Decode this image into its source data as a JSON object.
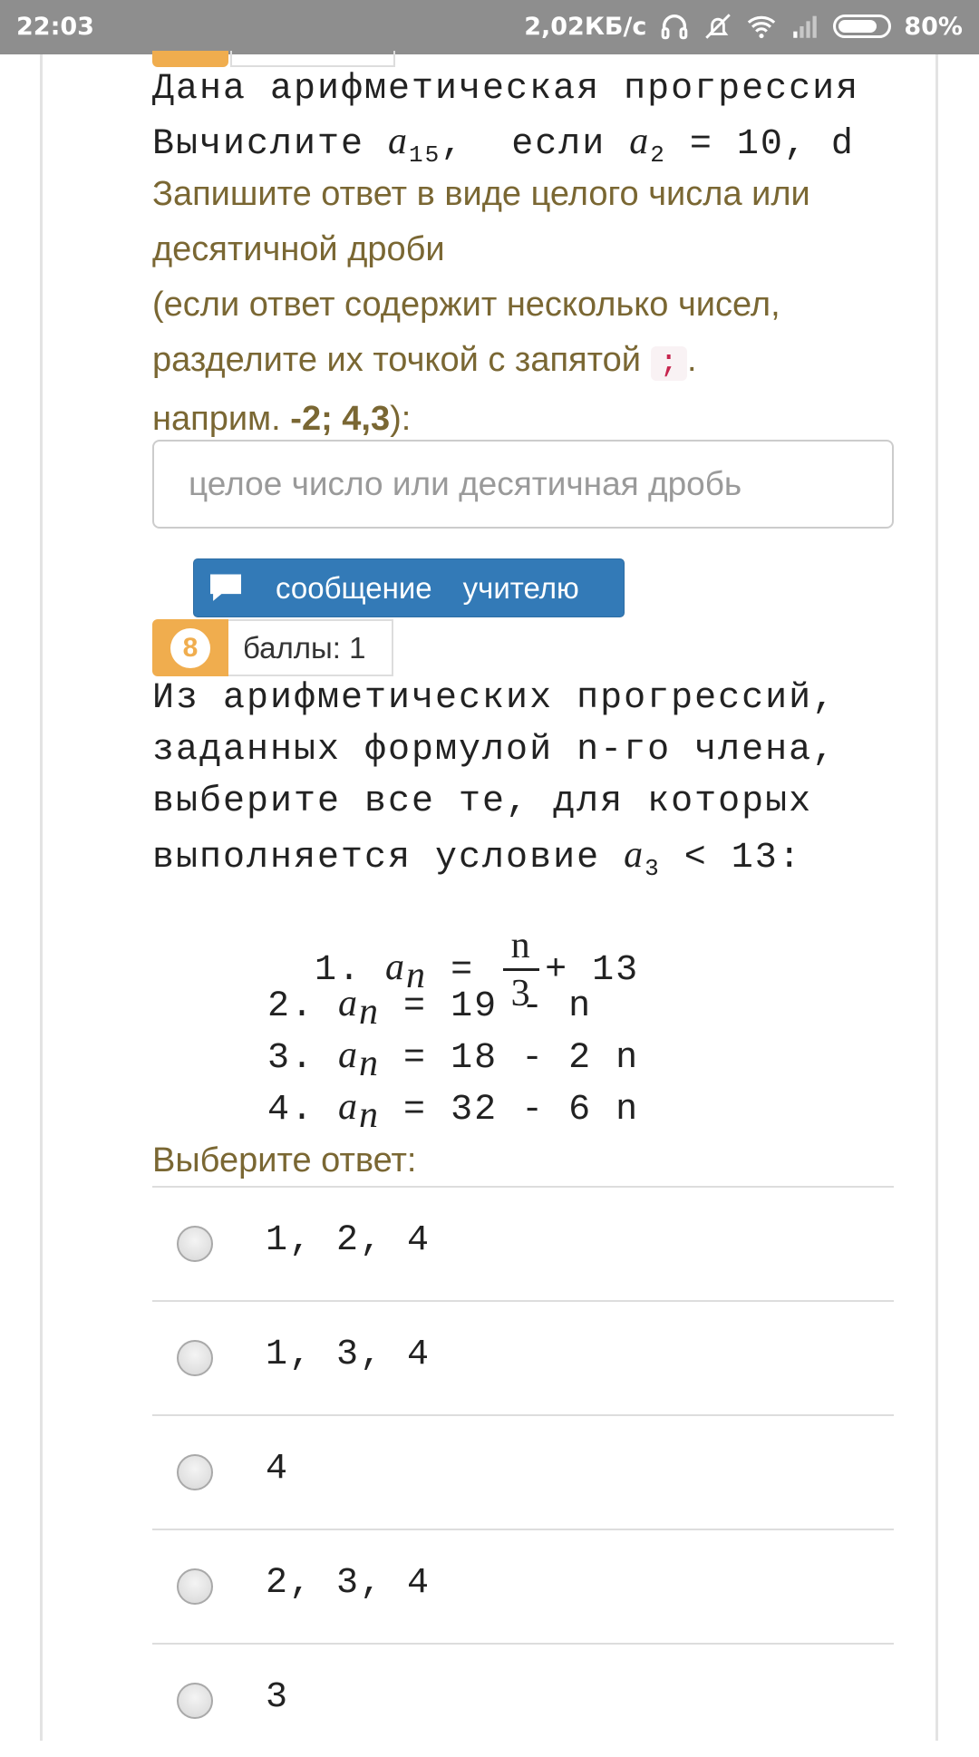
{
  "status_bar": {
    "time": "22:03",
    "net_speed": "2,02КБ/с",
    "battery": "80%",
    "battery_level": 0.8,
    "icons": [
      "headphones-icon",
      "vibrate-off-icon",
      "wifi-icon",
      "signal-icon",
      "battery-icon"
    ]
  },
  "q7": {
    "line1": "Дана арифметическая прогрессия",
    "line2_prefix": "Вычислите ",
    "line2_var1": "a",
    "line2_sub1": "15",
    "line2_mid": ",  если ",
    "line2_var2": "a",
    "line2_sub2": "2",
    "line2_suffix": " = 10, d",
    "instr1": "Запишите ответ в виде целого числа или",
    "instr2": "десятичной дроби",
    "instr3": "(если ответ содержит несколько чисел,",
    "instr4_text": "разделите их точкой с запятой ",
    "instr4_code": ";",
    "instr4_end": ".",
    "instr5_prefix": "наприм. ",
    "instr5_example": "-2; 4,3",
    "instr5_suffix": "):",
    "answer_placeholder": "целое число или десятичная дробь"
  },
  "message_button": {
    "word1": "сообщение",
    "word2": "учителю"
  },
  "q8": {
    "number": "8",
    "score": "баллы: 1",
    "text1": "Из арифметических прогрессий,",
    "text2": "заданных формулой n-го члена,",
    "text3": "выберите все те, для которых",
    "text4_prefix": "выполняется условие ",
    "text4_var": "a",
    "text4_sub": "3",
    "text4_suffix": " < 13:",
    "formulas": [
      {
        "num": "1.",
        "var": "a",
        "sub": "n",
        "eq": "=",
        "frac_num": "n",
        "frac_den": "3",
        "rest": "+ 13"
      },
      {
        "num": "2.",
        "var": "a",
        "sub": "n",
        "eq": "=",
        "rest": "19 - n"
      },
      {
        "num": "3.",
        "var": "a",
        "sub": "n",
        "eq": "=",
        "rest": "18 - 2 n"
      },
      {
        "num": "4.",
        "var": "a",
        "sub": "n",
        "eq": "=",
        "rest": "32 - 6 n"
      }
    ],
    "choose_label": "Выберите ответ:",
    "options": [
      "1, 2, 4",
      "1, 3, 4",
      "4",
      "2, 3, 4",
      "3"
    ]
  },
  "colors": {
    "status_bar": "#8e8e8e",
    "badge": "#f0ad4e",
    "button": "#337ab7",
    "instruction_text": "#7a6733"
  }
}
